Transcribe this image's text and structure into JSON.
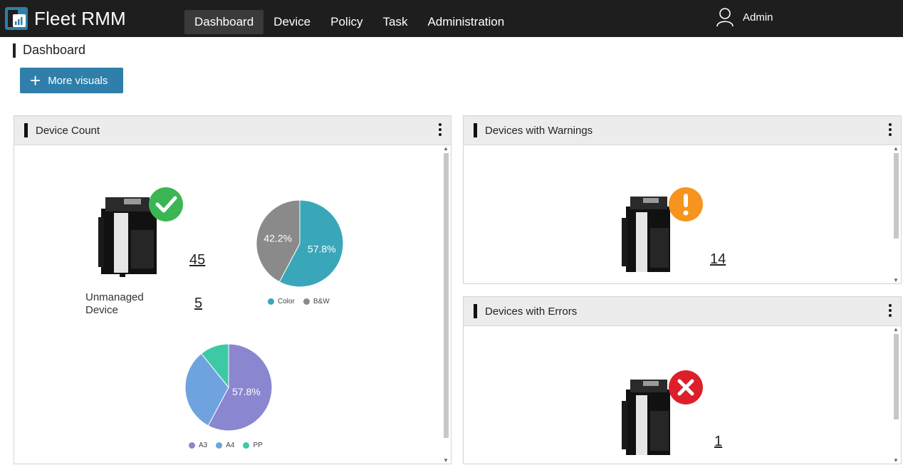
{
  "app": {
    "name": "Fleet RMM",
    "user": "Admin"
  },
  "nav": [
    {
      "label": "Dashboard",
      "active": true
    },
    {
      "label": "Device",
      "active": false
    },
    {
      "label": "Policy",
      "active": false
    },
    {
      "label": "Task",
      "active": false
    },
    {
      "label": "Administration",
      "active": false
    }
  ],
  "page": {
    "title": "Dashboard",
    "more_visuals_label": "More visuals"
  },
  "panels": {
    "device_count": {
      "title": "Device Count",
      "managed_count": "45",
      "unmanaged_label": "Unmanaged Device",
      "unmanaged_count": "5",
      "status_icon": "check-icon",
      "status_color": "#3cb554"
    },
    "warnings": {
      "title": "Devices with Warnings",
      "count": "14",
      "status_icon": "exclamation-icon",
      "status_color": "#f7941d"
    },
    "errors": {
      "title": "Devices with Errors",
      "count": "1",
      "status_icon": "x-icon",
      "status_color": "#dd1f2a"
    }
  },
  "chart_data": [
    {
      "type": "pie",
      "categories": [
        "Color",
        "B&W"
      ],
      "values": [
        57.8,
        42.2
      ],
      "data_labels": [
        "57.8%",
        "42.2%"
      ],
      "colors": [
        "#3aa6b9",
        "#8a8a8a"
      ],
      "legend_position": "bottom"
    },
    {
      "type": "pie",
      "categories": [
        "A3",
        "A4",
        "PP"
      ],
      "values": [
        57.8,
        31.4,
        10.8
      ],
      "data_labels": [
        "57.8%",
        "",
        ""
      ],
      "colors": [
        "#8b86d0",
        "#6ea3e0",
        "#3dc8a6"
      ],
      "legend_position": "bottom"
    }
  ]
}
